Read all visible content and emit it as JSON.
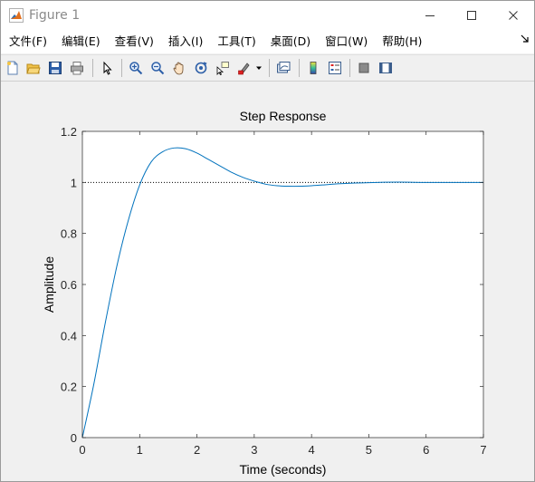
{
  "window": {
    "title": "Figure 1"
  },
  "menu": {
    "items": [
      "文件(F)",
      "编辑(E)",
      "查看(V)",
      "插入(I)",
      "工具(T)",
      "桌面(D)",
      "窗口(W)",
      "帮助(H)"
    ],
    "overflow_icon": "arrow-icon"
  },
  "toolbar": {
    "icons": [
      "new-figure-icon",
      "open-file-icon",
      "save-icon",
      "print-icon",
      "edit-plot-icon",
      "zoom-in-icon",
      "zoom-out-icon",
      "pan-icon",
      "rotate-3d-icon",
      "data-cursor-icon",
      "brush-icon",
      "brush-dropdown-icon",
      "link-plot-icon",
      "colorbar-icon",
      "legend-icon",
      "hide-plot-tools-icon",
      "show-plot-tools-icon"
    ]
  },
  "chart_data": {
    "type": "line",
    "title": "Step Response",
    "xlabel": "Time (seconds)",
    "ylabel": "Amplitude",
    "xlim": [
      0,
      7
    ],
    "ylim": [
      0,
      1.2
    ],
    "xticks": [
      "0",
      "1",
      "2",
      "3",
      "4",
      "5",
      "6",
      "7"
    ],
    "yticks": [
      "0",
      "0.2",
      "0.4",
      "0.6",
      "0.8",
      "1",
      "1.2"
    ],
    "grid": false,
    "legend": "none",
    "series": [
      {
        "color": "#0072bd",
        "x": [
          0,
          0.2,
          0.4,
          0.6,
          0.8,
          1.0,
          1.2,
          1.4,
          1.6,
          1.8,
          2.0,
          2.2,
          2.4,
          2.6,
          2.8,
          3.0,
          3.2,
          3.4,
          3.6,
          3.8,
          4.0,
          4.2,
          4.5,
          5.0,
          5.5,
          6.0,
          6.5,
          7.0
        ],
        "y": [
          0,
          0.21,
          0.45,
          0.67,
          0.85,
          0.99,
          1.08,
          1.12,
          1.135,
          1.132,
          1.115,
          1.09,
          1.065,
          1.04,
          1.02,
          1.005,
          0.993,
          0.987,
          0.985,
          0.985,
          0.987,
          0.99,
          0.995,
          0.999,
          1.001,
          1.0,
          1.0,
          1.0
        ]
      }
    ],
    "reference_line": {
      "y": 1.0,
      "style": "dotted",
      "color": "#000000"
    }
  },
  "colors": {
    "plot_line": "#0072bd",
    "axes": "#262626",
    "figure_bg": "#f0f0f0",
    "plot_bg": "#ffffff"
  }
}
